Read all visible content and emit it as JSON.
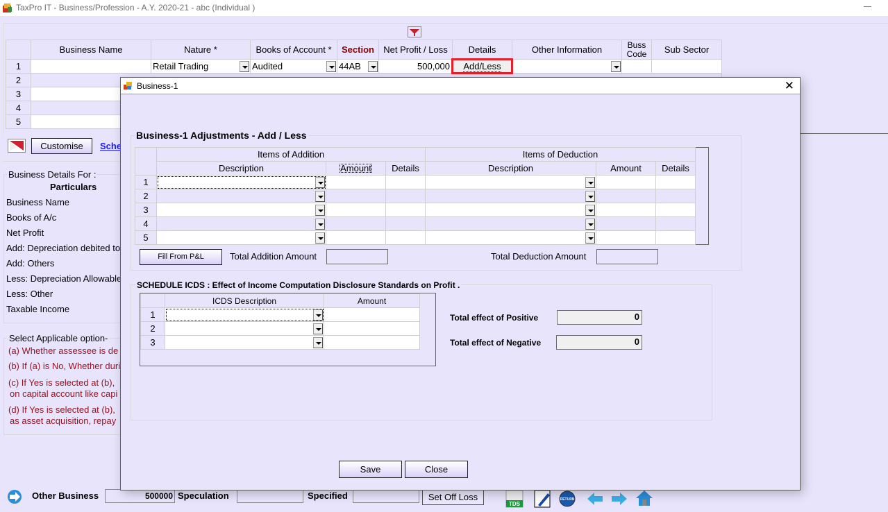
{
  "window": {
    "title": "TaxPro IT - Business/Profession - A.Y. 2020-21 - abc   (Individual )"
  },
  "main_grid": {
    "headers": [
      "Business Name",
      "Nature *",
      "Books of Account *",
      "Section",
      "Net Profit / Loss",
      "Details",
      "Other Information",
      "Buss Code",
      "Sub Sector"
    ],
    "buss_code_line1": "Buss",
    "buss_code_line2": "Code",
    "rows": [
      {
        "num": "1",
        "business_name": "",
        "nature": "Retail Trading",
        "books": "Audited",
        "section": "44AB",
        "net_profit": "500,000",
        "details": "Add/Less",
        "other_info": "",
        "buss_code": "",
        "sub_sector": ""
      },
      {
        "num": "2"
      },
      {
        "num": "3"
      },
      {
        "num": "4"
      },
      {
        "num": "5"
      }
    ]
  },
  "toolbar": {
    "customise_label": "Customise",
    "schedule_link": "Sche"
  },
  "business_details": {
    "legend": "Business Details For :",
    "particulars_header": "Particulars",
    "items": [
      "Business Name",
      "Books of A/c",
      "Net Profit",
      "Add: Depreciation debited to",
      "Add: Others",
      "Less: Depreciation Allowable",
      "Less: Other",
      "Taxable Income"
    ]
  },
  "applicable_options": {
    "legend": "Select Applicable option-",
    "a": "(a) Whether assessee is de",
    "b": "(b) If (a) is No, Whether duri",
    "c1": "(c)  If Yes is selected at (b),",
    "c2": "on capital account like capi",
    "d1": "(d)  If Yes is selected at (b),",
    "d2": "as asset acquisition, repay"
  },
  "bottom_bar": {
    "other_business_label": "Other Business",
    "other_business_value": "500000",
    "speculation_label": "Speculation",
    "speculation_value": "",
    "specified_label": "Specified",
    "specified_value": "",
    "set_off_loss_label": "Set Off Loss",
    "icons": [
      "tds-icon",
      "edit-pen-icon",
      "return-icon",
      "back-arrow-icon",
      "forward-arrow-icon",
      "home-icon"
    ],
    "tds_text": "TDS",
    "return_text": "RETURN"
  },
  "dialog": {
    "title": "Business-1",
    "adjustments": {
      "legend": "Business-1  Adjustments - Add / Less",
      "addition_group": "Items of Addition",
      "deduction_group": "Items of Deduction",
      "columns": {
        "description": "Description",
        "amount": "Amount",
        "details": "Details"
      },
      "rows": [
        "1",
        "2",
        "3",
        "4",
        "5"
      ],
      "fill_button": "Fill From P&L",
      "total_addition_label": "Total Addition Amount",
      "total_addition_value": "",
      "total_deduction_label": "Total Deduction Amount",
      "total_deduction_value": ""
    },
    "icds": {
      "legend": "SCHEDULE ICDS : Effect of Income Computation Disclosure Standards on Profit .",
      "col_description": "ICDS Description",
      "col_amount": "Amount",
      "rows": [
        "1",
        "2",
        "3"
      ],
      "positive_label": "Total effect of Positive",
      "positive_value": "0",
      "negative_label": "Total effect of Negative",
      "negative_value": "0"
    },
    "save_label": "Save",
    "close_label": "Close"
  },
  "colors": {
    "background": "#e8e4fc",
    "highlight_red": "#e8202a",
    "section_header": "#8b0000",
    "option_text": "#9a0f1f",
    "link": "#1a1aff"
  }
}
